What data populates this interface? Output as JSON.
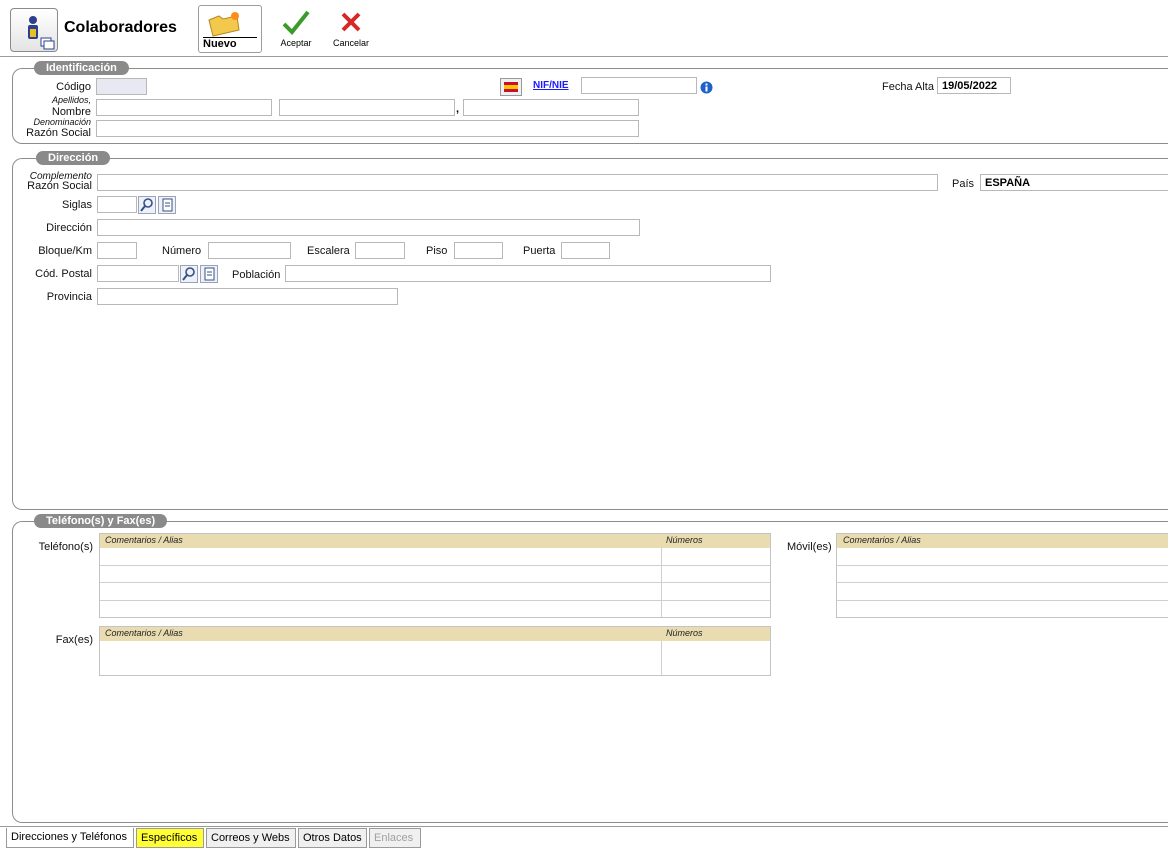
{
  "window": {
    "title": "Colaboradores"
  },
  "toolbar": {
    "new_label": "Nuevo",
    "accept_label": "Aceptar",
    "cancel_label": "Cancelar"
  },
  "identificacion": {
    "title": "Identificación",
    "codigo_label": "Código",
    "nif_label": "NIF/NIE",
    "fecha_alta_label": "Fecha Alta",
    "fecha_alta_value": "19/05/2022",
    "apellidos_label_1": "Apellidos,",
    "apellidos_label_2": "Nombre",
    "comma": ",",
    "denominacion_label": "Denominación",
    "razon_social_label": "Razón Social"
  },
  "direccion": {
    "title": "Dirección",
    "complemento_label_1": "Complemento",
    "complemento_label_2": "Razón Social",
    "pais_label": "País",
    "pais_value": "ESPAÑA",
    "siglas_label": "Siglas",
    "direccion_label": "Dirección",
    "bloque_label": "Bloque/Km",
    "numero_label": "Número",
    "escalera_label": "Escalera",
    "piso_label": "Piso",
    "puerta_label": "Puerta",
    "cod_postal_label": "Cód. Postal",
    "poblacion_label": "Población",
    "provincia_label": "Provincia"
  },
  "telefonos": {
    "title": "Teléfono(s) y Fax(es)",
    "telefonos_label": "Teléfono(s)",
    "moviles_label": "Móvil(es)",
    "fax_label": "Fax(es)",
    "col_comentarios": "Comentarios / Alias",
    "col_numeros": "Números"
  },
  "tabs": [
    {
      "label": "Direcciones y Teléfonos"
    },
    {
      "label": "Específicos"
    },
    {
      "label": "Correos y Webs"
    },
    {
      "label": "Otros Datos"
    },
    {
      "label": "Enlaces"
    }
  ],
  "colors": {
    "highlight": "#ffff33",
    "section_bg": "#8a8a8a",
    "grid_header": "#e8dcb0",
    "link": "#1a1aff"
  }
}
